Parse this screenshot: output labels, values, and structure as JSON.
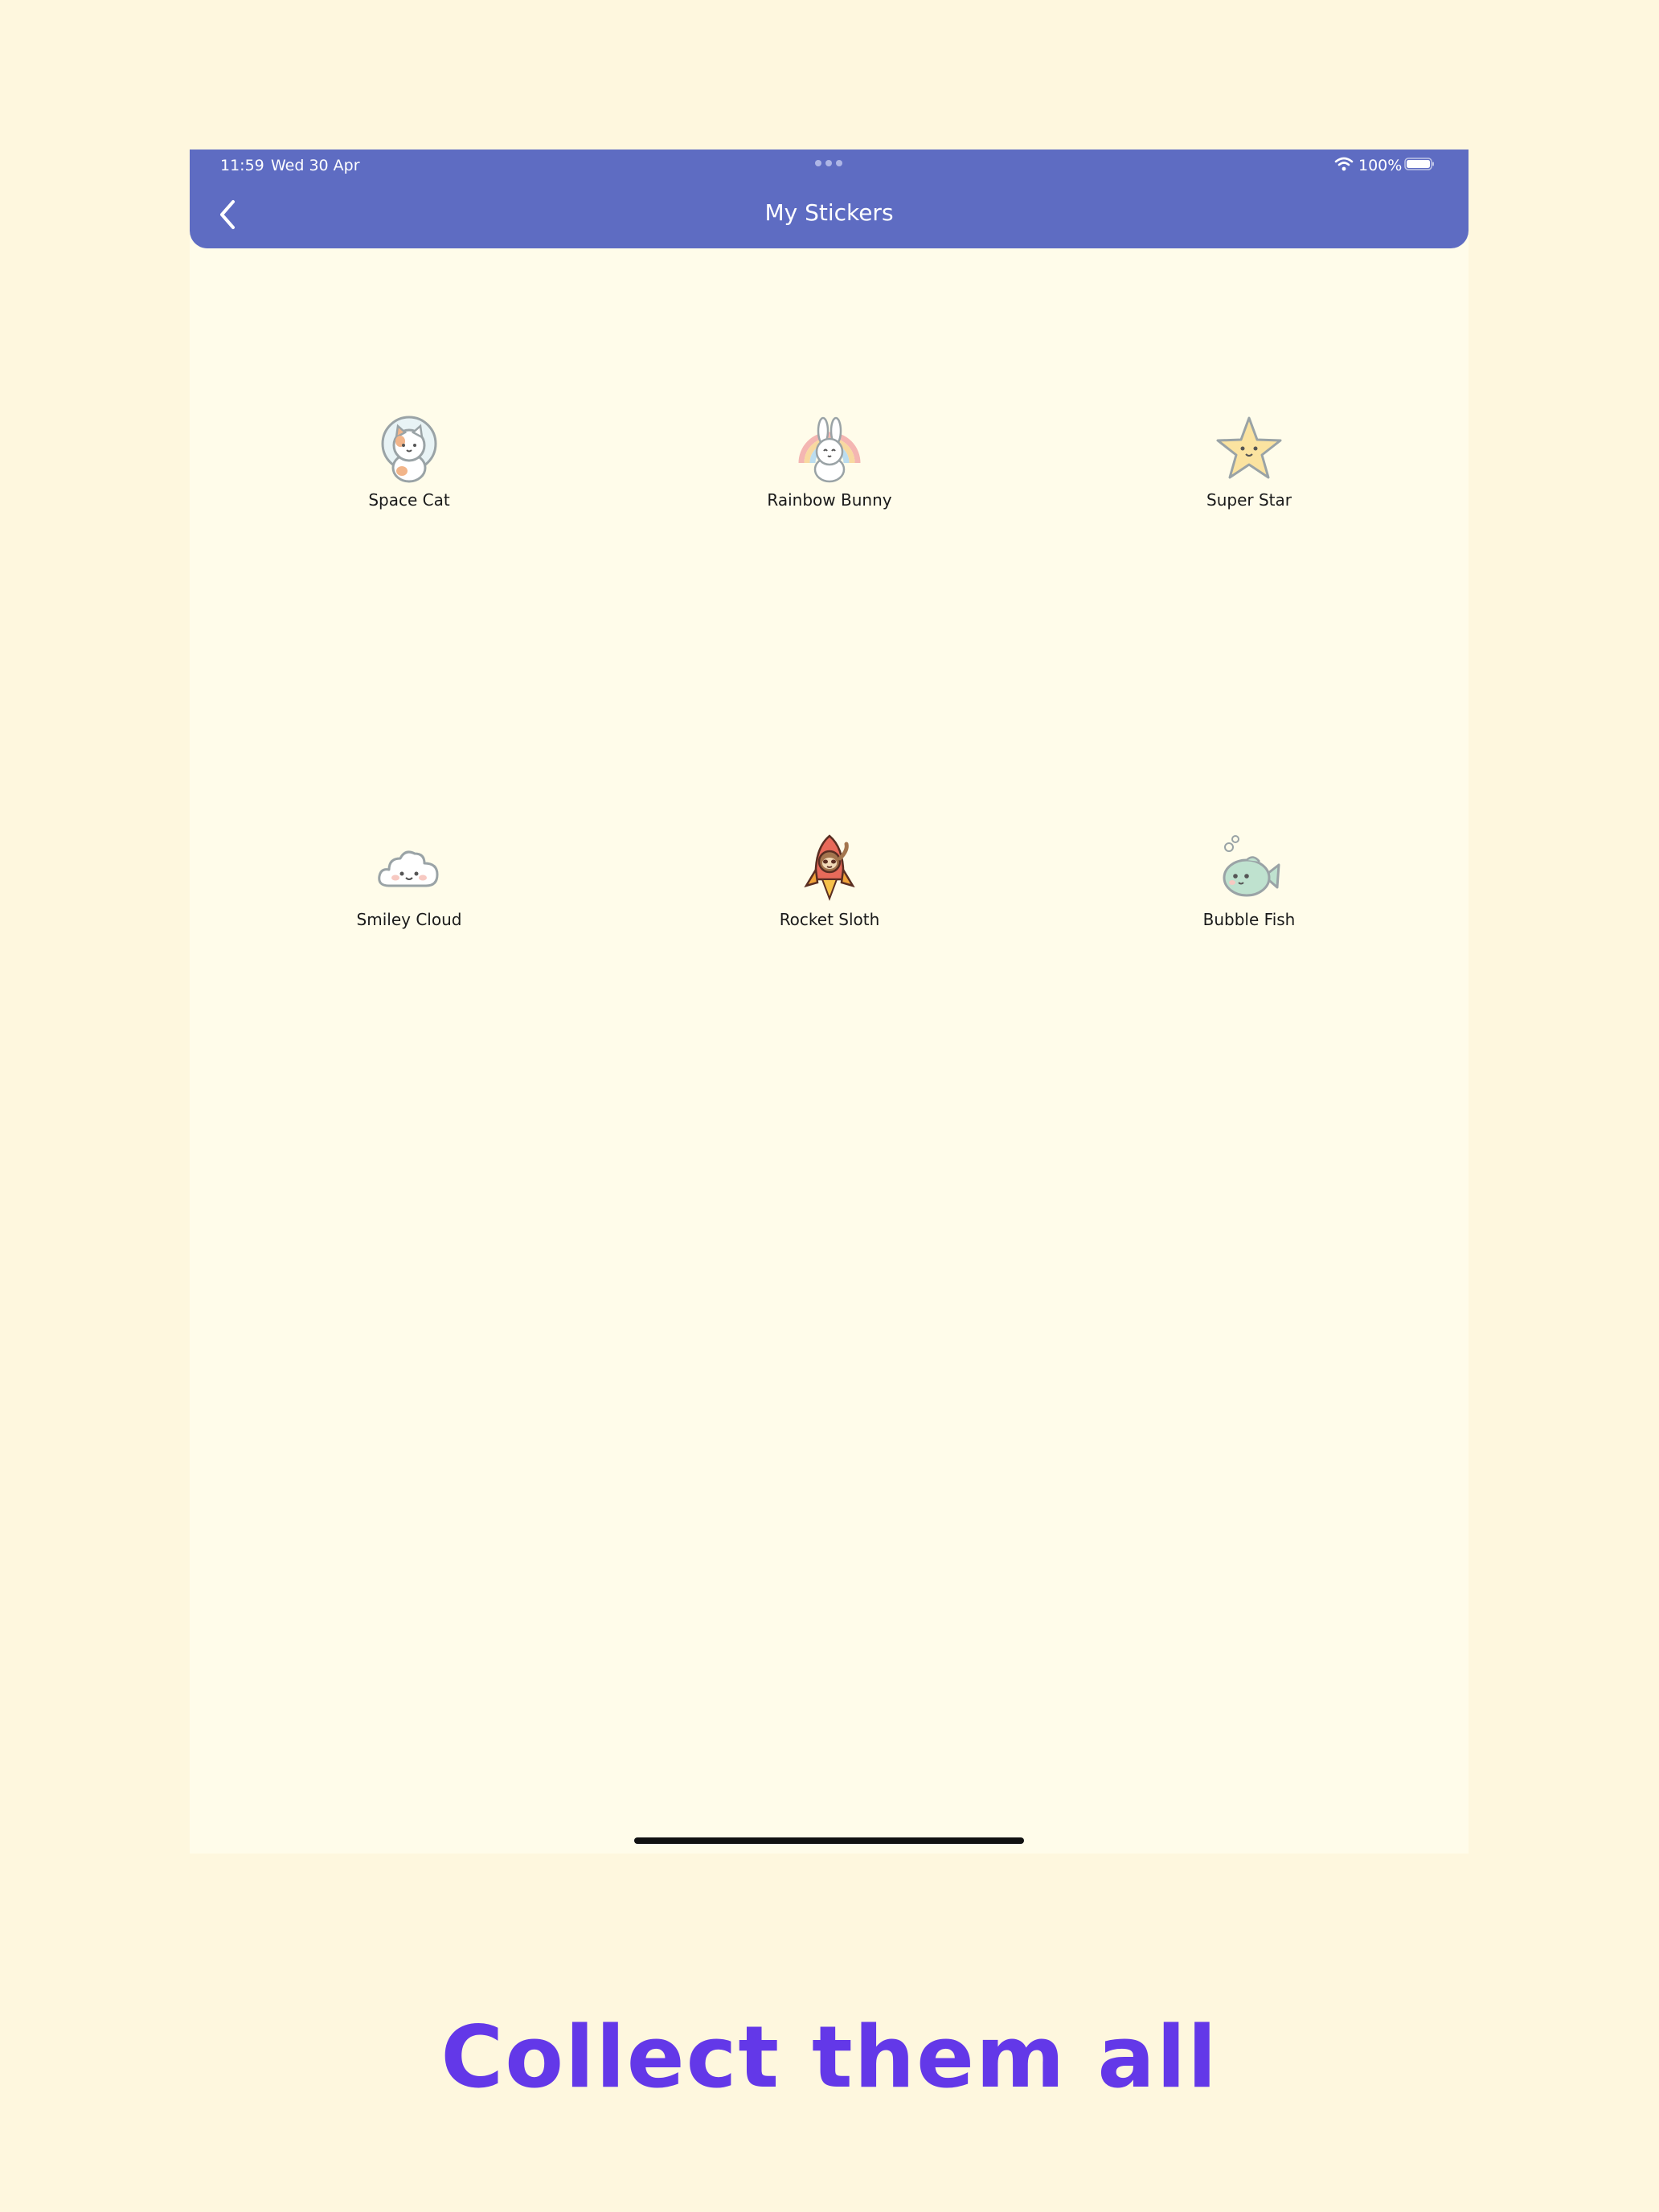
{
  "status_bar": {
    "time": "11:59",
    "date": "Wed 30 Apr",
    "battery": "100%"
  },
  "nav": {
    "title": "My Stickers",
    "back_icon": "chevron-left-icon"
  },
  "stickers": [
    {
      "label": "Space Cat",
      "icon": "space-cat-icon"
    },
    {
      "label": "Rainbow Bunny",
      "icon": "rainbow-bunny-icon"
    },
    {
      "label": "Super Star",
      "icon": "super-star-icon"
    },
    {
      "label": "Smiley Cloud",
      "icon": "smiley-cloud-icon"
    },
    {
      "label": "Rocket Sloth",
      "icon": "rocket-sloth-icon"
    },
    {
      "label": "Bubble Fish",
      "icon": "bubble-fish-icon"
    }
  ],
  "tagline": "Collect them all",
  "colors": {
    "page_background": "#FEF7DE",
    "screen_background": "#FFFCEA",
    "nav_bar": "#5E6CC2",
    "tagline": "#6338E8"
  }
}
